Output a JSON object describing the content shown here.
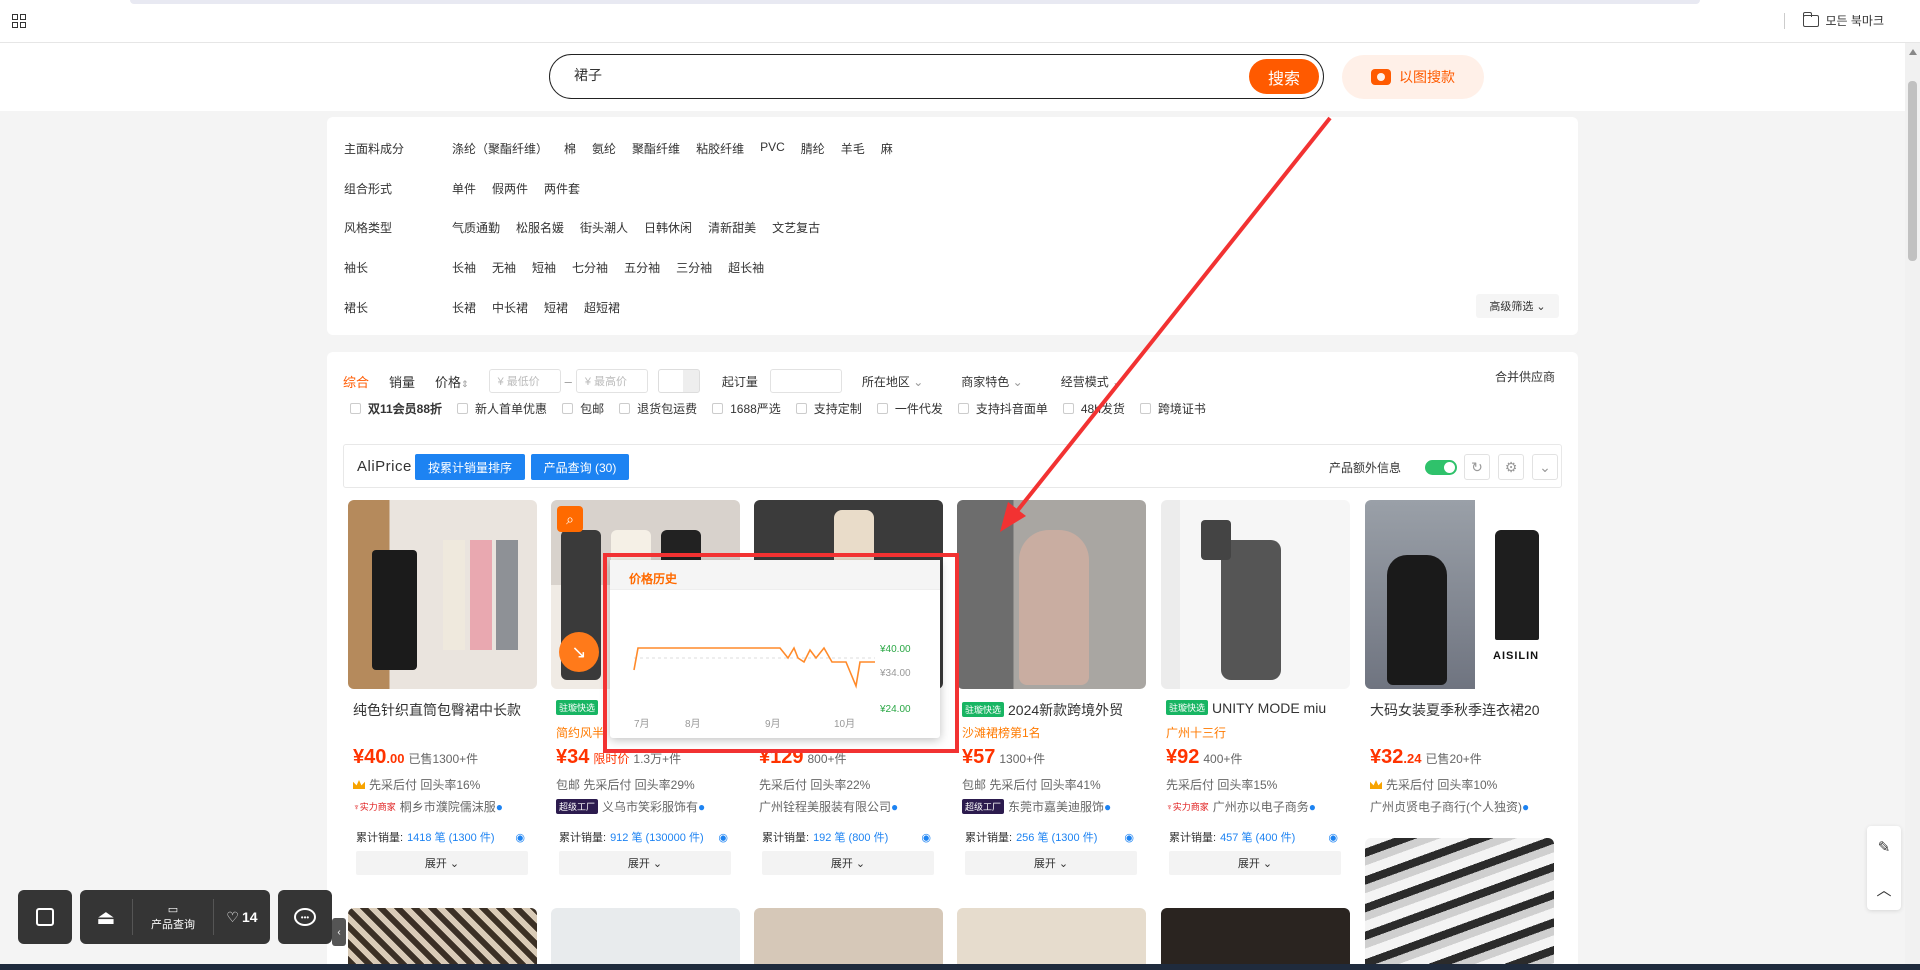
{
  "browser": {
    "bookmarks_label": "모든 북마크"
  },
  "search": {
    "query": "裙子",
    "button": "搜索",
    "image_search": "以图搜款"
  },
  "filters": {
    "rows": [
      {
        "label": "主面料成分",
        "options": [
          "涤纶（聚酯纤维）",
          "棉",
          "氨纶",
          "聚酯纤维",
          "粘胶纤维",
          "PVC",
          "腈纶",
          "羊毛",
          "麻"
        ]
      },
      {
        "label": "组合形式",
        "options": [
          "单件",
          "假两件",
          "两件套"
        ]
      },
      {
        "label": "风格类型",
        "options": [
          "气质通勤",
          "松服名媛",
          "街头潮人",
          "日韩休闲",
          "清新甜美",
          "文艺复古"
        ]
      },
      {
        "label": "袖长",
        "options": [
          "长袖",
          "无袖",
          "短袖",
          "七分袖",
          "五分袖",
          "三分袖",
          "超长袖"
        ]
      },
      {
        "label": "裙长",
        "options": [
          "长裙",
          "中长裙",
          "短裙",
          "超短裙"
        ]
      }
    ],
    "advanced": "高级筛选"
  },
  "sort": {
    "items": [
      "综合",
      "销量",
      "价格"
    ],
    "price_min": "¥ 最低价",
    "price_max": "¥ 最高价",
    "dash": "–",
    "moq": "起订量",
    "region": "所在地区",
    "feature": "商家特色",
    "mode": "经营模式",
    "merge": "合并供应商"
  },
  "checks": [
    "双11会员88折",
    "新人首单优惠",
    "包邮",
    "退货包运费",
    "1688严选",
    "支持定制",
    "一件代发",
    "支持抖音面单",
    "48h发货",
    "跨境证书"
  ],
  "aliprice": {
    "logo": "AliPrice",
    "btn_sort": "按累计销量排序",
    "btn_query": "产品查询 (30)",
    "extra_info": "产品额外信息",
    "toggle_color": "#2fc26b"
  },
  "price_history": {
    "title": "价格历史",
    "x_ticks": [
      "7月",
      "8月",
      "9月",
      "10月"
    ],
    "y_labels": [
      "¥40.00",
      "¥34.00",
      "¥24.00"
    ],
    "line_color": "#ff8a2a"
  },
  "products": [
    {
      "title": "纯色针织直筒包臀裙中长款",
      "tag": "",
      "sub": "",
      "price": "¥40",
      "cents": ".00",
      "sold": "已售1300+件",
      "promo": "",
      "l1": "先采后付  回头率16%",
      "crown": true,
      "badge": "实力商家",
      "badge_dark": false,
      "company": "桐乡市濮院儒沫服",
      "cum_label": "累计销量:",
      "cum_val": "1418 笔 (1300 件)",
      "expand": "展开"
    },
    {
      "title": "",
      "tag": "驻璇快选",
      "sub": "简约风半",
      "price": "¥34",
      "cents": "",
      "sold": "1.3万+件",
      "promo": "限时价",
      "l1": "包邮  先采后付  回头率29%",
      "crown": false,
      "badge": "超级工厂",
      "badge_dark": true,
      "company": "义乌市笑彩服饰有",
      "cum_label": "累计销量:",
      "cum_val": "912 笔 (130000 件)",
      "expand": "展开"
    },
    {
      "title": "",
      "tag": "",
      "sub": "",
      "price": "¥129",
      "cents": "",
      "sold": "800+件",
      "promo": "",
      "l1": "先采后付  回头率22%",
      "crown": false,
      "badge": "",
      "badge_dark": false,
      "company": "广州铨程美服装有限公司",
      "cum_label": "累计销量:",
      "cum_val": "192 笔 (800 件)",
      "expand": "展开"
    },
    {
      "title": "2024新款跨境外贸",
      "tag": "驻璇快选",
      "sub": "沙滩裙榜第1名",
      "price": "¥57",
      "cents": "",
      "sold": "1300+件",
      "promo": "",
      "l1": "包邮  先采后付  回头率41%",
      "crown": false,
      "badge": "超级工厂",
      "badge_dark": true,
      "company": "东莞市嘉美迪服饰",
      "cum_label": "累计销量:",
      "cum_val": "256 笔 (1300 件)",
      "expand": "展开"
    },
    {
      "title": "UNITY MODE miu",
      "tag": "驻璇快选",
      "sub": "广州十三行",
      "price": "¥92",
      "cents": "",
      "sold": "400+件",
      "promo": "",
      "l1": "先采后付  回头率15%",
      "crown": false,
      "badge": "实力商家",
      "badge_dark": false,
      "company": "广州亦以电子商务",
      "cum_label": "累计销量:",
      "cum_val": "457 笔 (400 件)",
      "expand": "展开"
    },
    {
      "title": "大码女装夏季秋季连衣裙20",
      "tag": "",
      "sub": "",
      "price": "¥32",
      "cents": ".24",
      "sold": "已售20+件",
      "promo": "",
      "l1": "先采后付  回头率10%",
      "crown": true,
      "badge": "",
      "badge_dark": false,
      "company": "广州贞贤电子商行(个人独资)",
      "cum_label": "",
      "cum_val": "",
      "expand": ""
    }
  ],
  "brand_text": "AISILIN",
  "bottom": {
    "query": "产品查询",
    "favs": "14"
  },
  "accent": "#ff5a00"
}
